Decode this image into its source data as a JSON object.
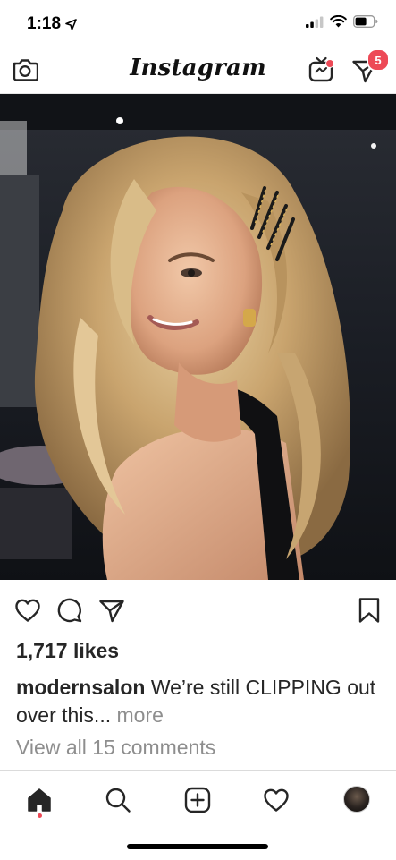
{
  "status_bar": {
    "time": "1:18",
    "icons": [
      "location-arrow-icon",
      "cellular-signal-icon",
      "wifi-icon",
      "battery-icon"
    ]
  },
  "header": {
    "logo_text": "Instagram",
    "icons": [
      "camera-icon",
      "igtv-icon",
      "direct-message-icon"
    ],
    "direct_badge_count": "5",
    "accent_color": "#ed4956"
  },
  "post": {
    "image_description_icon": "photo-icon",
    "actions": [
      "heart-icon",
      "comment-icon",
      "share-icon",
      "bookmark-icon"
    ],
    "likes": "1,717 likes",
    "caption": {
      "username": "modernsalon",
      "text": "We’re still CLIPPING out over this...",
      "more_label": "more"
    },
    "view_comments": "View all 15 comments"
  },
  "bottom_nav": {
    "items": [
      "home-icon",
      "search-icon",
      "add-post-icon",
      "activity-heart-icon",
      "profile-avatar"
    ]
  }
}
